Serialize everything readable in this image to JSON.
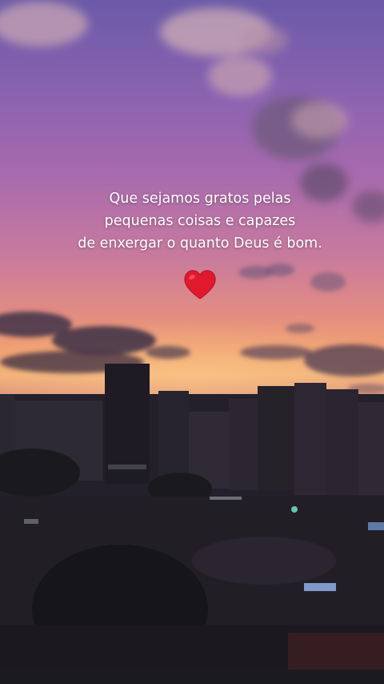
{
  "story": {
    "quote_lines": [
      "Que sejamos gratos pelas",
      "pequenas coisas e capazes",
      "de enxergar o quanto Deus é bom."
    ],
    "emoji": "red-heart-icon",
    "colors": {
      "text": "#ffffff",
      "heart": "#e0192f",
      "sky_top": "#6a5aa8",
      "sky_horizon": "#f2b07a",
      "city": "#1e1b24"
    }
  }
}
